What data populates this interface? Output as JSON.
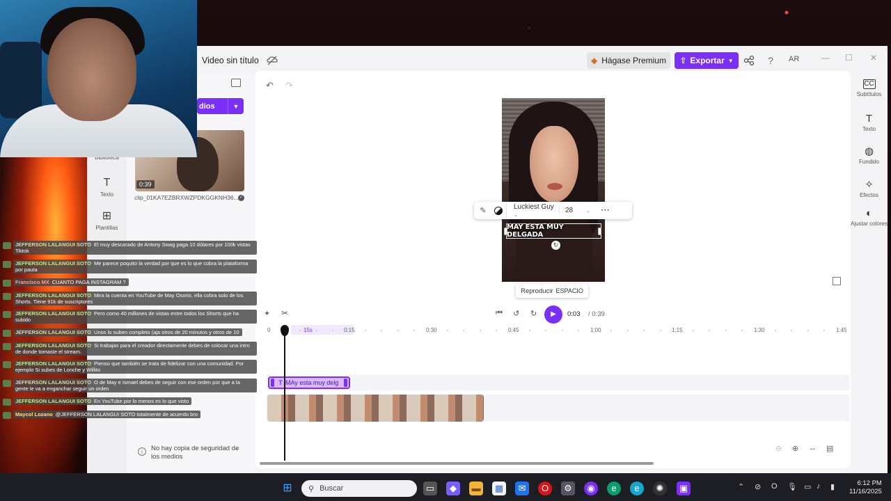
{
  "window": {
    "video_title": "Video sin título",
    "premium_label": "Hágase Premium",
    "export_label": "Exportar",
    "avatar": "AR",
    "help": "?"
  },
  "left_nav": {
    "items": [
      {
        "label": "Biblioteca",
        "icon": "library-icon"
      },
      {
        "label": "Texto",
        "icon": "text-icon"
      },
      {
        "label": "Plantillas",
        "icon": "templates-icon"
      }
    ]
  },
  "media_panel": {
    "import_label": "dios",
    "clip_duration": "0:39",
    "clip_name": "clip_01KA7EZBRXWZPDKGGKNH36...",
    "backup_notice": "No hay copia de seguridad de los medios"
  },
  "preview": {
    "caption": "MAY ESTA MUY DELGADA",
    "toolbar": {
      "font": "Luckiest Guy",
      "size": "28"
    },
    "tooltip_action": "Reproducir",
    "tooltip_key": "ESPACIO"
  },
  "playback": {
    "current_time": "0:03",
    "total_time": "/ 0:39"
  },
  "timeline": {
    "ruler_labels": [
      "0",
      "0:15",
      "0:30",
      "0:45",
      "1:00",
      "1:15",
      "1:30",
      "1:45"
    ],
    "range_label": "15s",
    "text_clip_label": "MAy esta muy delg",
    "text_clip_icon": "T"
  },
  "right_rail": {
    "items": [
      {
        "label": "Subtítulos",
        "icon": "captions-icon"
      },
      {
        "label": "Texto",
        "icon": "text-icon"
      },
      {
        "label": "Fundido",
        "icon": "fade-icon"
      },
      {
        "label": "Efectos",
        "icon": "effects-icon"
      },
      {
        "label": "Ajustar colores",
        "icon": "adjust-colors-icon"
      }
    ]
  },
  "chat": [
    {
      "user": "JEFFERSON LALANGUI SOTO",
      "text": "El muy descarado de Antony Swag paga 10 dólares por 100k vistas Tiktok"
    },
    {
      "user": "JEFFERSON LALANGUI SOTO",
      "text": "Me parece poquito la verdad por que es lo que cobra la plataforma por pauta"
    },
    {
      "user": "Francisco MX",
      "text": "CUANTO PAGA INSTAGRAM ?"
    },
    {
      "user": "JEFFERSON LALANGUI SOTO",
      "text": "Mira la cuenta en YouTube de May Osorio, ella cobra solo de los Shorts. Tiene 91k de suscriptores"
    },
    {
      "user": "JEFFERSON LALANGUI SOTO",
      "text": "Pero como 40 millones de vistas entre todos los Shorts que ha subido"
    },
    {
      "user": "JEFFERSON LALANGUI SOTO",
      "text": "Unos lo suben completo (aja otros de 20 minutos y otros de 10"
    },
    {
      "user": "JEFFERSON LALANGUI SOTO",
      "text": "Si trabajas para el creador directamente debes de colocar una intro de donde tomaste el stream."
    },
    {
      "user": "JEFFERSON LALANGUI SOTO",
      "text": "Pienso que también se trata de fidelizar con una comunidad. Por ejemplo Si subes de Lonche y Willito"
    },
    {
      "user": "JEFFERSON LALANGUI SOTO",
      "text": "O de May e Ismael debes de seguir con ese orden por que a la gente le va a enganchar seguir un orden"
    },
    {
      "user": "JEFFERSON LALANGUI SOTO",
      "text": "En YouTube por lo menos es lo que visto"
    },
    {
      "user": "Maycol Lozano",
      "text": "@JEFFERSON LALANGUI SOTO totalmente de acuerdo bro"
    }
  ],
  "taskbar": {
    "search_placeholder": "Buscar",
    "time": "6:12 PM",
    "date": "11/16/2025"
  },
  "colors": {
    "accent": "#7b2ff7",
    "app_bg": "#f4f4f6",
    "taskbar_bg": "#1d1d24"
  }
}
